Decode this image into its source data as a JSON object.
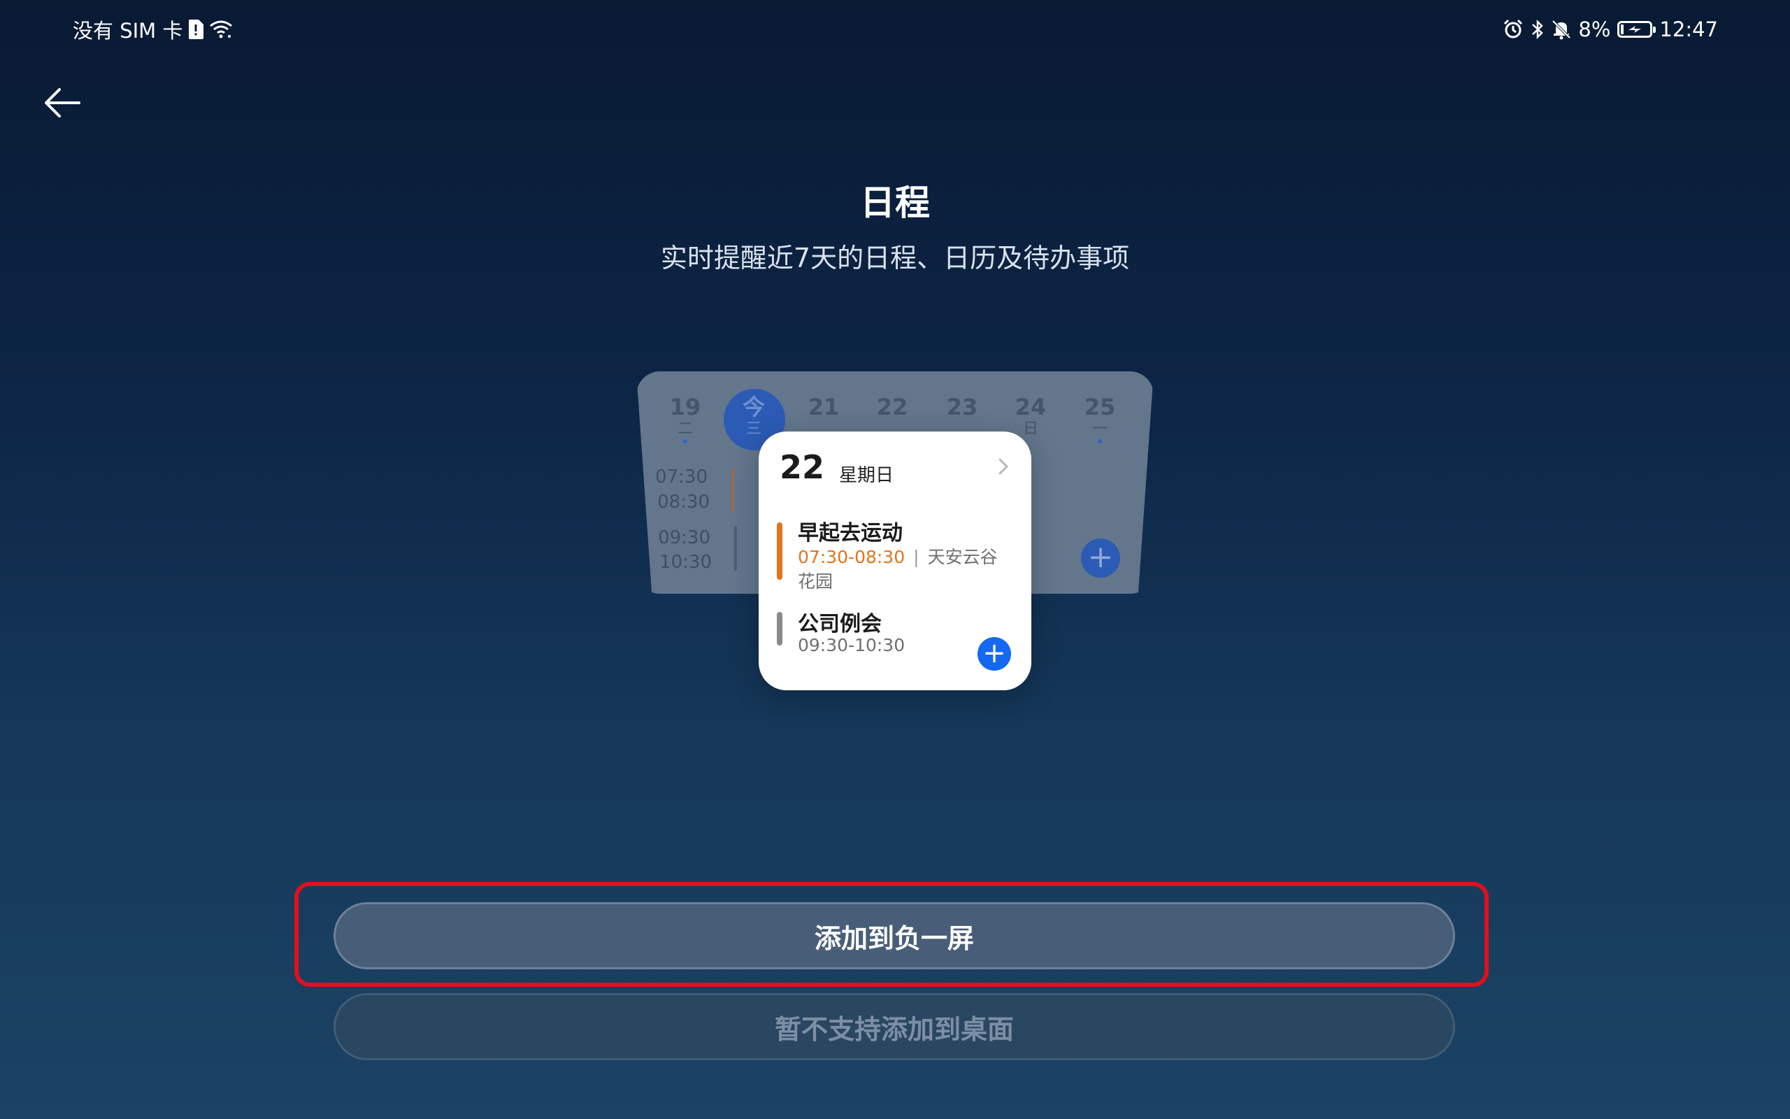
{
  "status_bar": {
    "carrier": "没有 SIM 卡",
    "battery_percent": "8%",
    "time": "12:47",
    "icons": [
      "sim-alert-icon",
      "wifi-icon",
      "alarm-icon",
      "bluetooth-icon",
      "mute-icon",
      "battery-charging-icon"
    ]
  },
  "header": {
    "title": "日程",
    "subtitle": "实时提醒近7天的日程、日历及待办事项"
  },
  "preview_bg": {
    "days": [
      {
        "num": "19",
        "week": "二"
      },
      {
        "num": "今",
        "week": "三"
      },
      {
        "num": "21",
        "week": ""
      },
      {
        "num": "22",
        "week": ""
      },
      {
        "num": "23",
        "week": ""
      },
      {
        "num": "24",
        "week": "日"
      },
      {
        "num": "25",
        "week": "一"
      }
    ],
    "times": [
      "07:30",
      "08:30",
      "09:30",
      "10:30"
    ],
    "plus": "+"
  },
  "preview_card": {
    "date": "22",
    "weekday": "星期日",
    "events": [
      {
        "title": "早起去运动",
        "time": "07:30-08:30",
        "location": "天安云谷",
        "location_cont": "花园",
        "color": "#e2741a"
      },
      {
        "title": "公司例会",
        "time": "09:30-10:30",
        "color": "#8a8a8a"
      }
    ],
    "plus": "+"
  },
  "actions": {
    "add_to_minus_one": "添加到负一屏",
    "add_to_desktop_disabled": "暂不支持添加到桌面"
  },
  "colors": {
    "highlight": "#e0101c",
    "accent_blue": "#1468f2",
    "event_orange": "#e2741a"
  }
}
